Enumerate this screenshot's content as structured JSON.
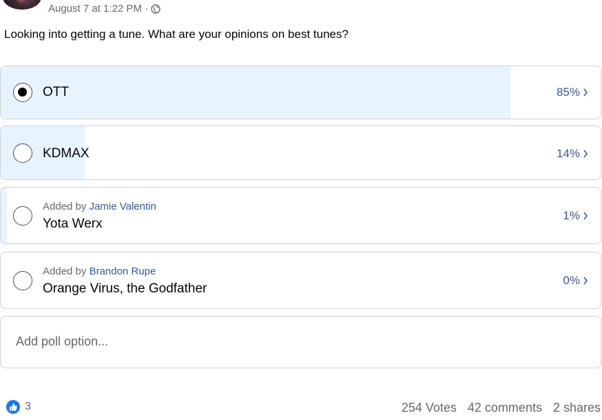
{
  "post": {
    "timestamp": "August 7 at 1:22 PM · ",
    "text": "Looking into getting a tune. What are your opinions on best tunes?"
  },
  "poll": {
    "options": [
      {
        "label": "OTT",
        "percent_label": "85%",
        "percent": 85,
        "selected": true,
        "added_by_prefix": "",
        "added_by_name": ""
      },
      {
        "label": "KDMAX",
        "percent_label": "14%",
        "percent": 14,
        "selected": false,
        "added_by_prefix": "",
        "added_by_name": ""
      },
      {
        "label": "Yota Werx",
        "percent_label": "1%",
        "percent": 1,
        "selected": false,
        "added_by_prefix": "Added by ",
        "added_by_name": "Jamie Valentin"
      },
      {
        "label": "Orange Virus, the Godfather",
        "percent_label": "0%",
        "percent": 0,
        "selected": false,
        "added_by_prefix": "Added by ",
        "added_by_name": "Brandon Rupe"
      }
    ],
    "add_option_placeholder": "Add poll option..."
  },
  "footer": {
    "reactions_count": "3",
    "votes": "254 Votes",
    "comments": "42 comments",
    "shares": "2 shares"
  },
  "icons": {
    "privacy": "globe-icon",
    "reaction": "like-icon",
    "percent_arrow": "chevron-right-icon"
  },
  "colors": {
    "fill": "#e7f3ff",
    "accent": "#385898",
    "like": "#1877f2"
  }
}
